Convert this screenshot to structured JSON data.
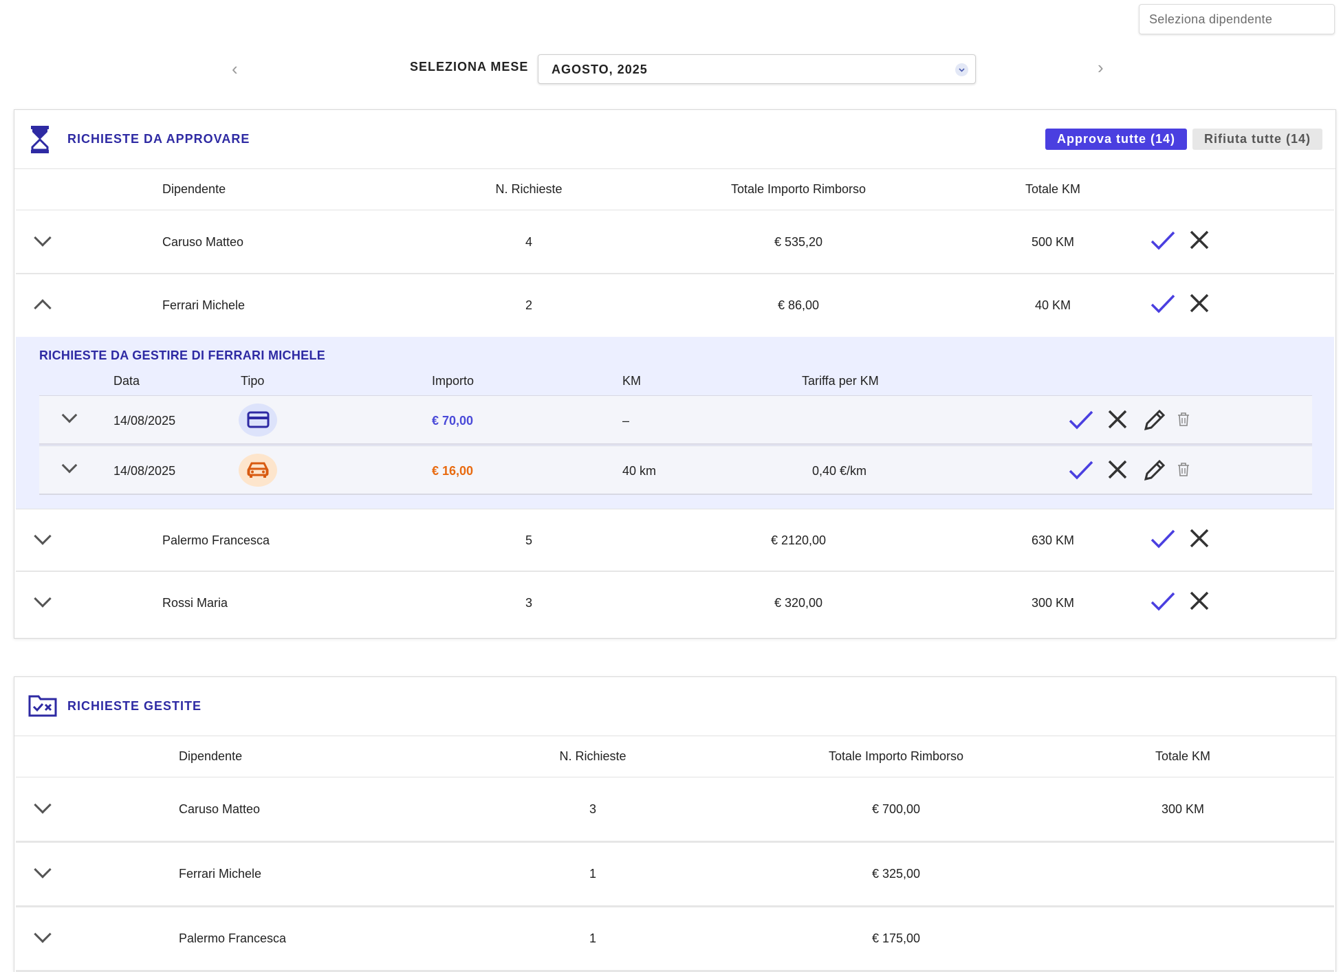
{
  "employee_select": {
    "placeholder": "Seleziona dipendente"
  },
  "month": {
    "label": "SELEZIONA MESE",
    "value": "AGOSTO, 2025"
  },
  "pending": {
    "title": "RICHIESTE DA APPROVARE",
    "approve_all": "Approva tutte (14)",
    "reject_all": "Rifiuta tutte (14)",
    "columns": [
      "Dipendente",
      "N. Richieste",
      "Totale Importo Rimborso",
      "Totale KM"
    ],
    "rows": [
      {
        "name": "Caruso Matteo",
        "count": "4",
        "amount": "€ 535,20",
        "km": "500 KM"
      },
      {
        "name": "Ferrari Michele",
        "count": "2",
        "amount": "€ 86,00",
        "km": "40 KM"
      },
      {
        "name": "Palermo Francesca",
        "count": "5",
        "amount": "€ 2120,00",
        "km": "630 KM"
      },
      {
        "name": "Rossi Maria",
        "count": "3",
        "amount": "€ 320,00",
        "km": "300 KM"
      }
    ],
    "detail": {
      "title": "RICHIESTE DA GESTIRE DI FERRARI MICHELE",
      "columns": [
        "Data",
        "Tipo",
        "Importo",
        "KM",
        "Tariffa per KM"
      ],
      "items": [
        {
          "date": "14/08/2025",
          "type_icon": "credit-card-icon",
          "amount": "€ 70,00",
          "km": "–",
          "rate": ""
        },
        {
          "date": "14/08/2025",
          "type_icon": "car-icon",
          "amount": "€ 16,00",
          "km": "40 km",
          "rate": "0,40 €/km"
        }
      ]
    }
  },
  "handled": {
    "title": "RICHIESTE GESTITE",
    "columns": [
      "Dipendente",
      "N. Richieste",
      "Totale Importo Rimborso",
      "Totale KM"
    ],
    "rows": [
      {
        "name": "Caruso Matteo",
        "count": "3",
        "amount": "€ 700,00",
        "km": "300 KM"
      },
      {
        "name": "Ferrari Michele",
        "count": "1",
        "amount": "€ 325,00",
        "km": ""
      },
      {
        "name": "Palermo Francesca",
        "count": "1",
        "amount": "€ 175,00",
        "km": ""
      }
    ]
  },
  "colors": {
    "accent": "#4a3fe0",
    "title": "#2e2aa3",
    "orange": "#e86a10",
    "detail_bg": "#ecefff"
  }
}
